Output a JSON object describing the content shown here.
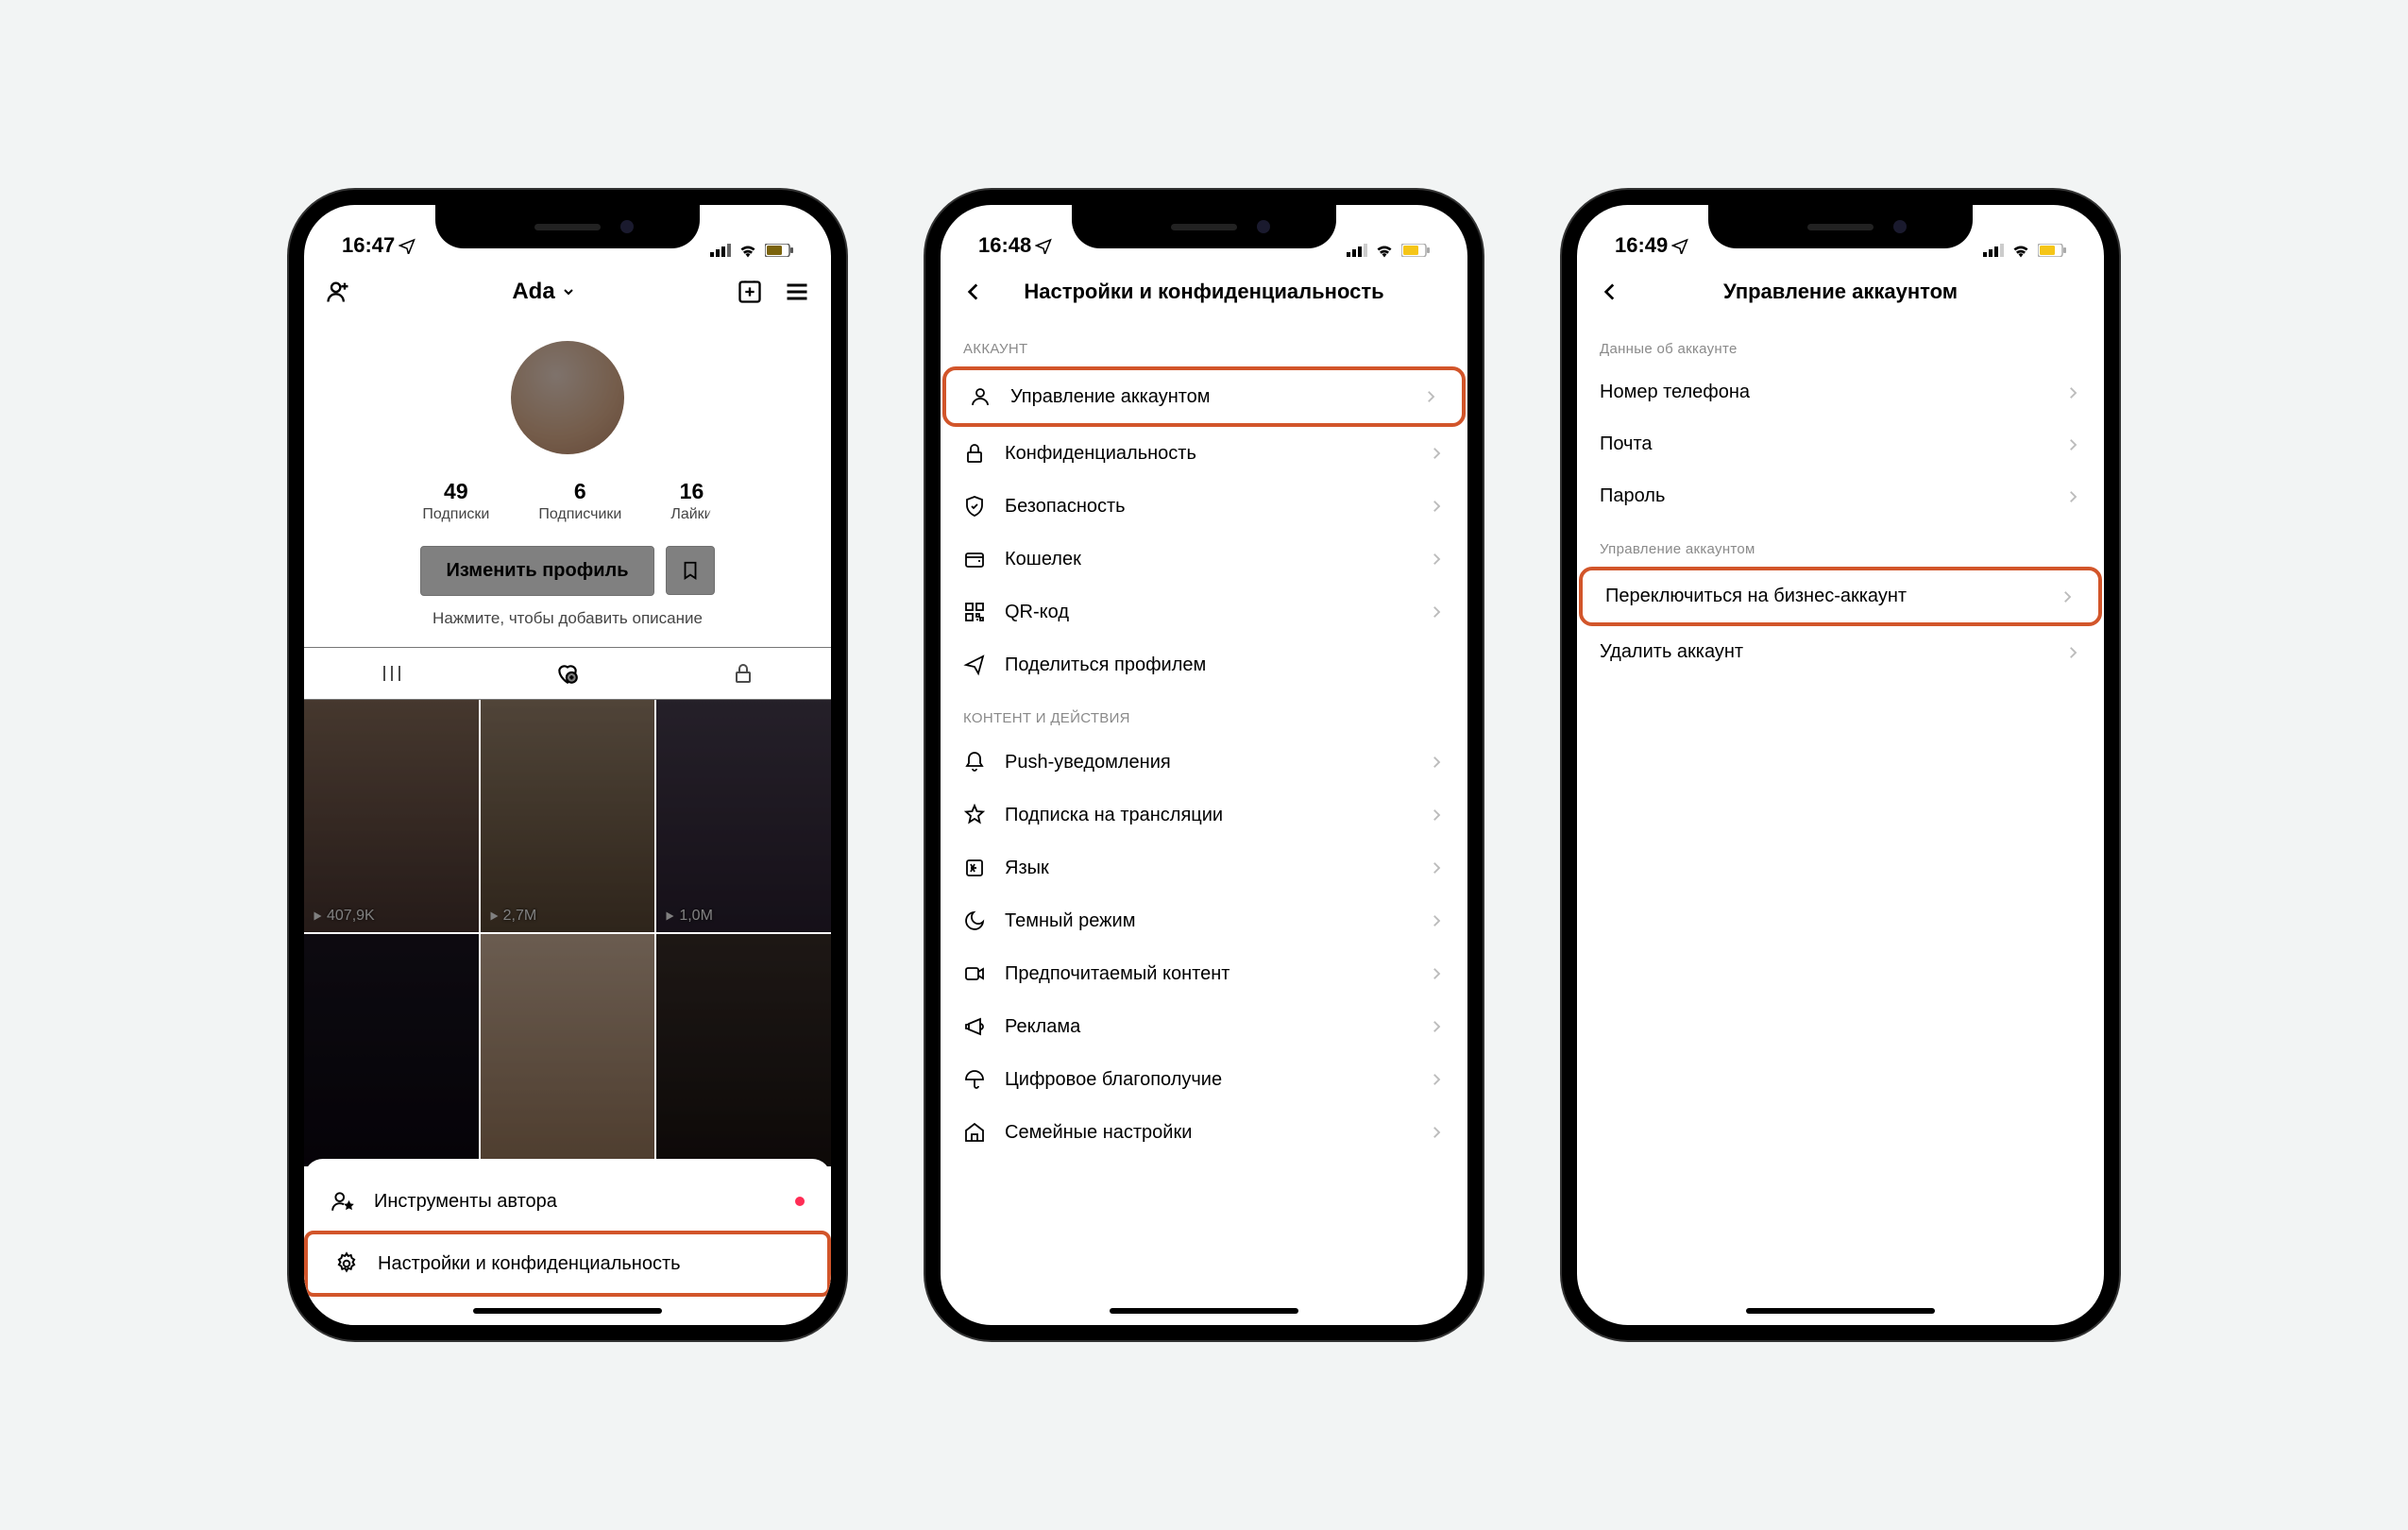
{
  "phone1": {
    "time": "16:47",
    "username": "Ada",
    "stats": {
      "following": {
        "value": "49",
        "label": "Подписки"
      },
      "followers": {
        "value": "6",
        "label": "Подписчики"
      },
      "likes": {
        "value": "16",
        "label": "Лайки"
      }
    },
    "editProfile": "Изменить профиль",
    "bio": "Нажмите, чтобы добавить описание",
    "videoViews": [
      "407,9K",
      "2,7M",
      "1,0M"
    ],
    "sheet": {
      "creator": "Инструменты автора",
      "settings": "Настройки и конфиденциальность"
    }
  },
  "phone2": {
    "time": "16:48",
    "title": "Настройки и конфиденциальность",
    "sections": {
      "account": {
        "label": "АККАУНТ",
        "items": [
          "Управление аккаунтом",
          "Конфиденциальность",
          "Безопасность",
          "Кошелек",
          "QR-код",
          "Поделиться профилем"
        ]
      },
      "content": {
        "label": "КОНТЕНТ И ДЕЙСТВИЯ",
        "items": [
          "Push-уведомления",
          "Подписка на трансляции",
          "Язык",
          "Темный режим",
          "Предпочитаемый контент",
          "Реклама",
          "Цифровое благополучие",
          "Семейные настройки"
        ]
      }
    }
  },
  "phone3": {
    "time": "16:49",
    "title": "Управление аккаунтом",
    "sections": {
      "data": {
        "label": "Данные об аккаунте",
        "items": [
          "Номер телефона",
          "Почта",
          "Пароль"
        ]
      },
      "manage": {
        "label": "Управление аккаунтом",
        "items": [
          "Переключиться на бизнес-аккаунт",
          "Удалить аккаунт"
        ]
      }
    }
  }
}
